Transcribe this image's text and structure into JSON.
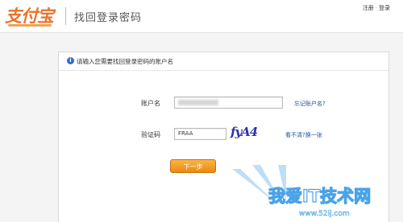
{
  "header": {
    "logo_text": "支付宝",
    "page_title": "找回登录密码",
    "links": {
      "register": "注册",
      "separator": "·",
      "login": "登录"
    }
  },
  "panel": {
    "info_icon": "info-icon",
    "title": "请输入您需要找回登录密码的账户名"
  },
  "form": {
    "account_label": "账户名",
    "account_value": "",
    "forgot_account_link": "忘记账户名?",
    "captcha_label": "验证码",
    "captcha_value": "FRAA",
    "captcha_image_text": "fyA4",
    "refresh_captcha_link": "看不清?换一张",
    "next_button": "下一步"
  },
  "watermark": {
    "text": "我爱IT技术网",
    "url": "www.52ij.com"
  },
  "colors": {
    "brand_orange": "#e8732a",
    "link_blue": "#1a4f9c",
    "button_orange": "#ec8a10",
    "captcha_blue": "#2f2fb0",
    "watermark_blue": "#4aa3e8"
  }
}
